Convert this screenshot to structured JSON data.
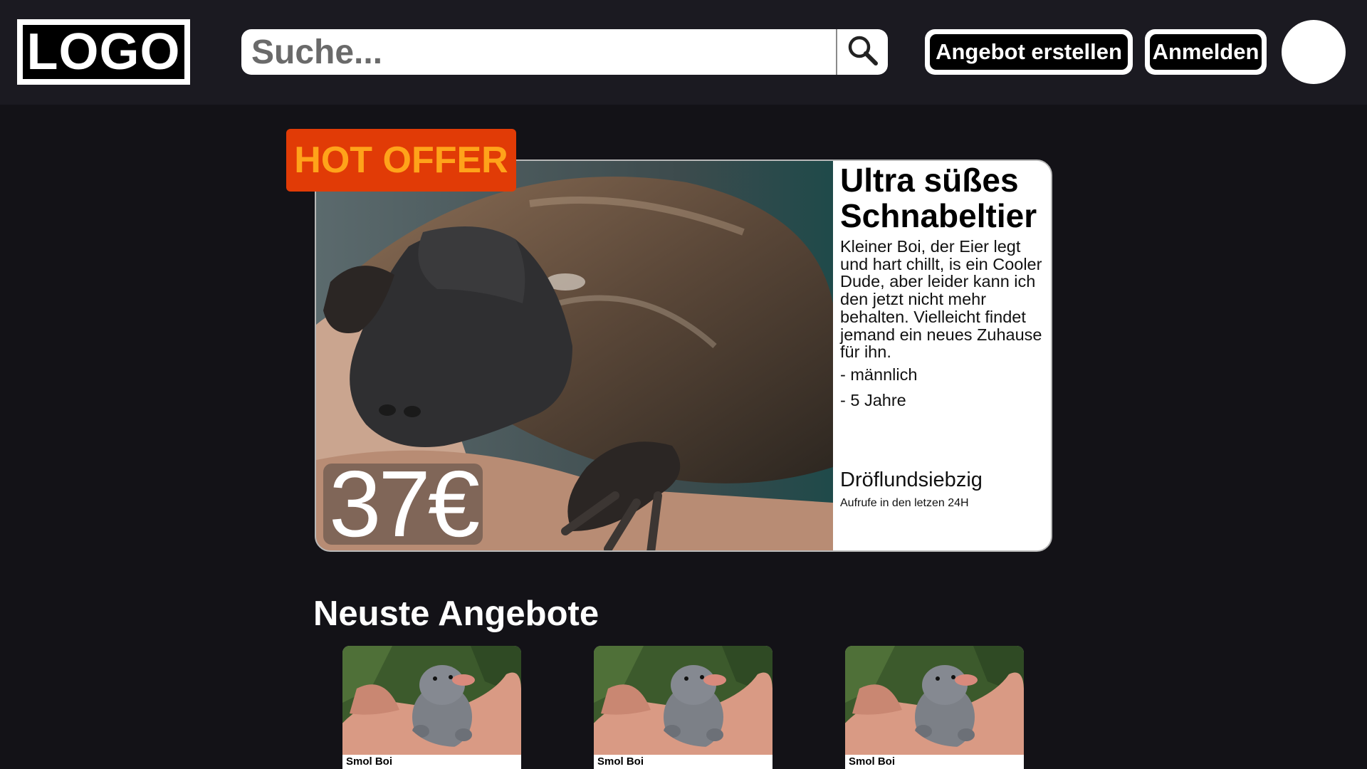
{
  "header": {
    "logo_text": "LOGO",
    "search": {
      "placeholder": "Suche..."
    },
    "buttons": {
      "create_offer": "Angebot erstellen",
      "login": "Anmelden"
    }
  },
  "featured": {
    "badge": "HOT OFFER",
    "title": "Ultra süßes Schnabeltier",
    "description": "Kleiner Boi, der Eier legt und hart chillt, is ein Cooler Dude, aber leider kann ich den jetzt nicht mehr behalten. Vielleicht findet jemand ein neues Zuhause für ihn.",
    "facts": [
      "- männlich",
      "- 5 Jahre"
    ],
    "views": "Dröflundsiebzig",
    "views_label": "Aufrufe in den letzen 24H",
    "price": "37€"
  },
  "latest": {
    "title": "Neuste Angebote",
    "items": [
      {
        "name": "Smol Boi"
      },
      {
        "name": "Smol Boi"
      },
      {
        "name": "Smol Boi"
      }
    ]
  },
  "colors": {
    "page_bg": "#131217",
    "header_bg": "#1b1a21",
    "badge_bg": "#e13b06",
    "badge_text": "#ffa31a"
  },
  "icons": {
    "search": "search-icon"
  }
}
